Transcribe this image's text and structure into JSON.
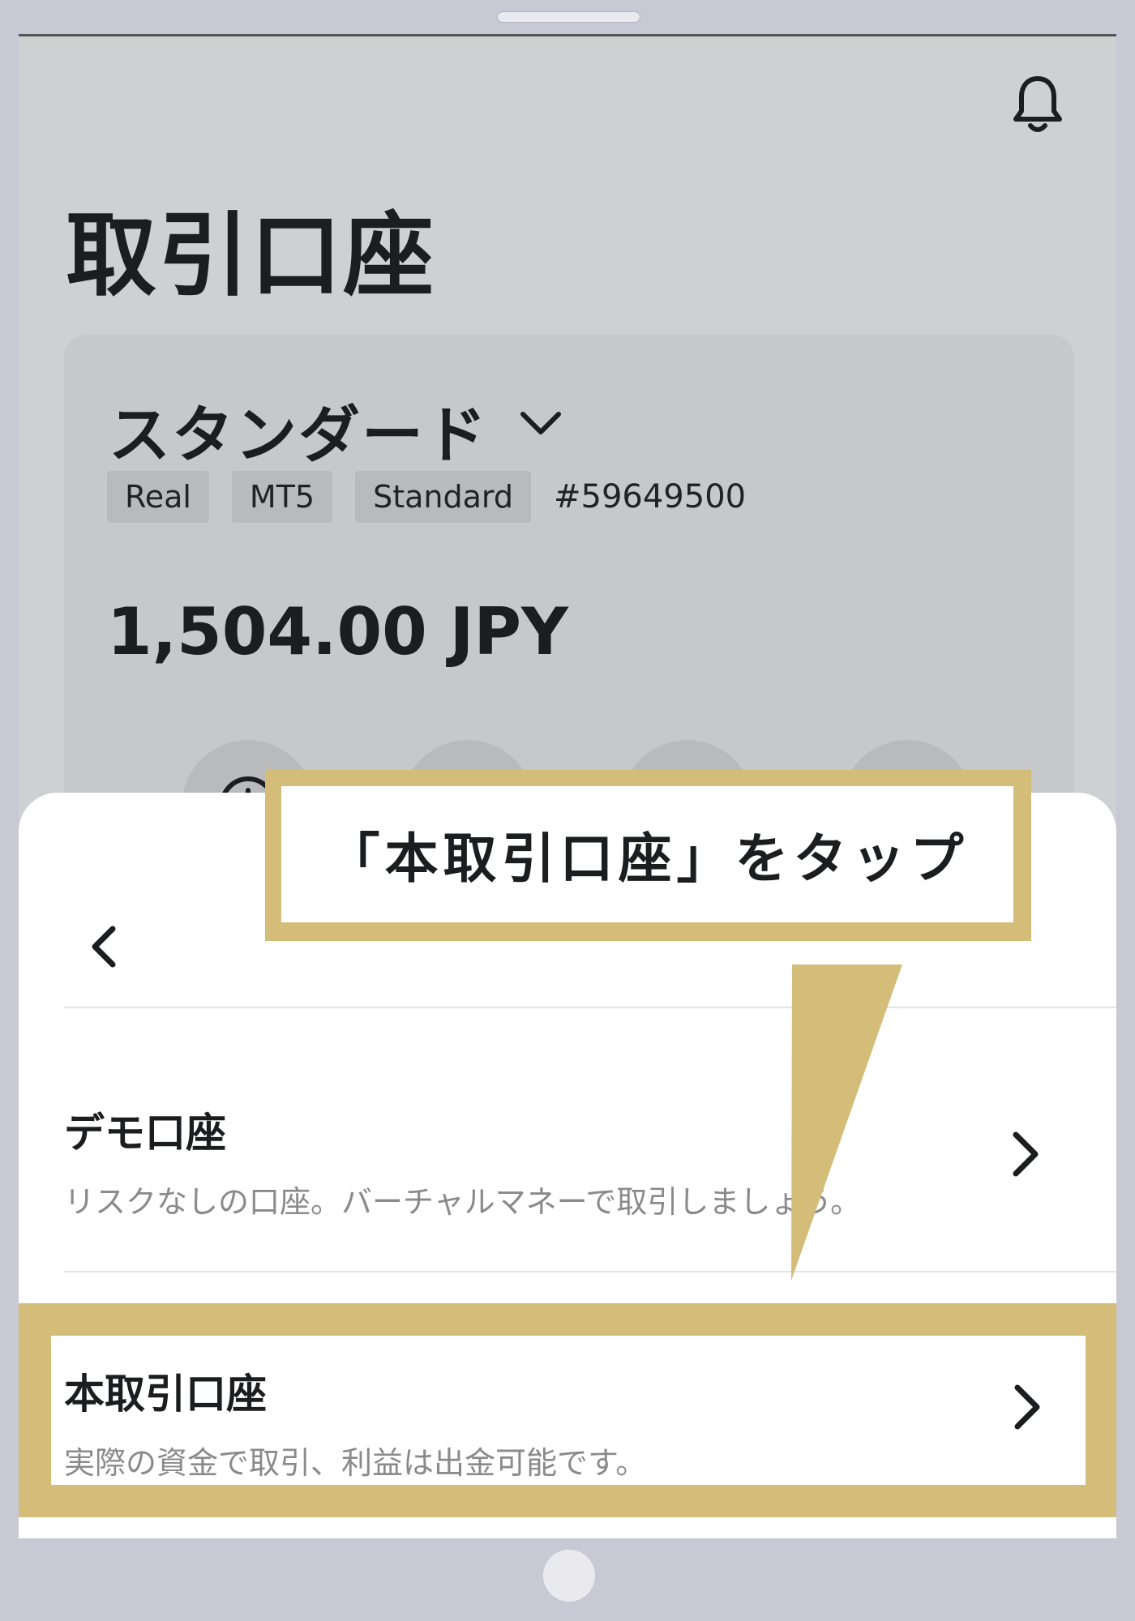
{
  "header": {
    "title": "取引口座",
    "bell_icon": "bell-icon"
  },
  "account_card": {
    "name": "スタンダード",
    "chips": [
      "Real",
      "MT5",
      "Standard"
    ],
    "account_number": "#59649500",
    "balance": "1,504.00 JPY",
    "actions": [
      "deposit-icon",
      "withdraw-icon",
      "history-icon",
      "menu-list-icon"
    ]
  },
  "sheet": {
    "options": [
      {
        "title": "デモ口座",
        "desc": "リスクなしの口座。バーチャルマネーで取引しましょう。"
      },
      {
        "title": "本取引口座",
        "desc": "実際の資金で取引、利益は出金可能です。"
      }
    ]
  },
  "callout": {
    "text": "「本取引口座」をタップ"
  },
  "colors": {
    "highlight": "#d3bd78",
    "background_dim": "#cfd0d2"
  }
}
